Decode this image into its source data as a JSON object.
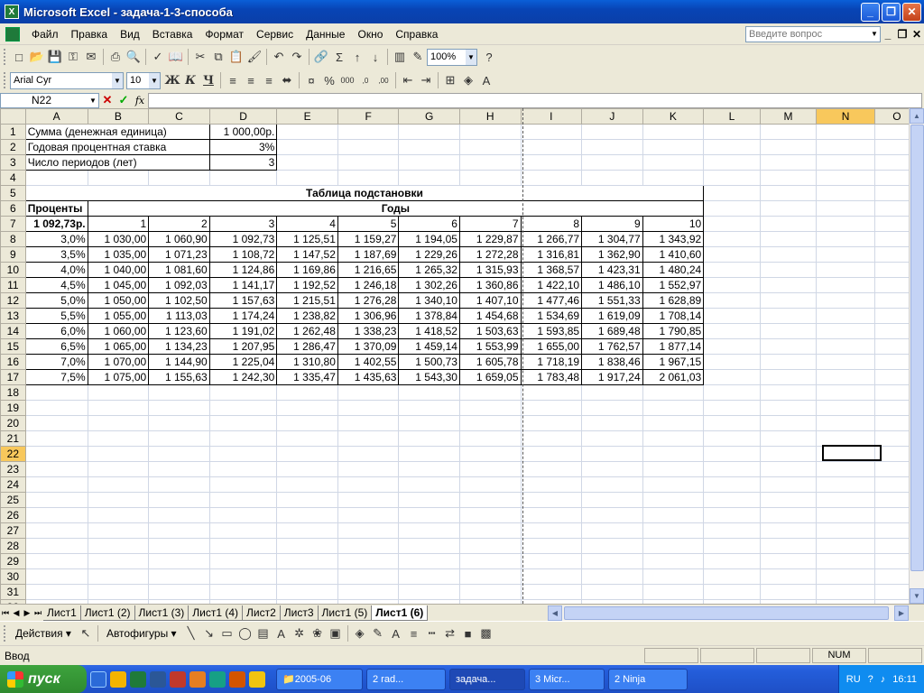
{
  "window": {
    "title": "Microsoft Excel - задача-1-3-способа"
  },
  "menu": {
    "items": [
      "Файл",
      "Правка",
      "Вид",
      "Вставка",
      "Формат",
      "Сервис",
      "Данные",
      "Окно",
      "Справка"
    ],
    "help_placeholder": "Введите вопрос"
  },
  "toolbar": {
    "zoom": "100%",
    "font": "Arial Cyr",
    "size": "10",
    "bold": "Ж",
    "italic": "К",
    "underline": "Ч"
  },
  "formula": {
    "namebox": "N22",
    "fx": "fx",
    "value": ""
  },
  "columns": [
    "A",
    "B",
    "C",
    "D",
    "E",
    "F",
    "G",
    "H",
    "I",
    "J",
    "K",
    "L",
    "M",
    "N",
    "O"
  ],
  "cells": {
    "A1": "Сумма (денежная единица)",
    "D1": "1 000,00р.",
    "A2": "Годовая процентная ставка",
    "D2": "3%",
    "A3": "Число периодов (лет)",
    "D3": "3",
    "E5": "Таблица подстановки",
    "A6": "Проценты",
    "F6": "Годы",
    "A7": "1 092,73р.",
    "years": [
      "1",
      "2",
      "3",
      "4",
      "5",
      "6",
      "7",
      "8",
      "9",
      "10"
    ],
    "rows": [
      {
        "rate": "3,0%",
        "vals": [
          "1 030,00",
          "1 060,90",
          "1 092,73",
          "1 125,51",
          "1 159,27",
          "1 194,05",
          "1 229,87",
          "1 266,77",
          "1 304,77",
          "1 343,92"
        ]
      },
      {
        "rate": "3,5%",
        "vals": [
          "1 035,00",
          "1 071,23",
          "1 108,72",
          "1 147,52",
          "1 187,69",
          "1 229,26",
          "1 272,28",
          "1 316,81",
          "1 362,90",
          "1 410,60"
        ]
      },
      {
        "rate": "4,0%",
        "vals": [
          "1 040,00",
          "1 081,60",
          "1 124,86",
          "1 169,86",
          "1 216,65",
          "1 265,32",
          "1 315,93",
          "1 368,57",
          "1 423,31",
          "1 480,24"
        ]
      },
      {
        "rate": "4,5%",
        "vals": [
          "1 045,00",
          "1 092,03",
          "1 141,17",
          "1 192,52",
          "1 246,18",
          "1 302,26",
          "1 360,86",
          "1 422,10",
          "1 486,10",
          "1 552,97"
        ]
      },
      {
        "rate": "5,0%",
        "vals": [
          "1 050,00",
          "1 102,50",
          "1 157,63",
          "1 215,51",
          "1 276,28",
          "1 340,10",
          "1 407,10",
          "1 477,46",
          "1 551,33",
          "1 628,89"
        ]
      },
      {
        "rate": "5,5%",
        "vals": [
          "1 055,00",
          "1 113,03",
          "1 174,24",
          "1 238,82",
          "1 306,96",
          "1 378,84",
          "1 454,68",
          "1 534,69",
          "1 619,09",
          "1 708,14"
        ]
      },
      {
        "rate": "6,0%",
        "vals": [
          "1 060,00",
          "1 123,60",
          "1 191,02",
          "1 262,48",
          "1 338,23",
          "1 418,52",
          "1 503,63",
          "1 593,85",
          "1 689,48",
          "1 790,85"
        ]
      },
      {
        "rate": "6,5%",
        "vals": [
          "1 065,00",
          "1 134,23",
          "1 207,95",
          "1 286,47",
          "1 370,09",
          "1 459,14",
          "1 553,99",
          "1 655,00",
          "1 762,57",
          "1 877,14"
        ]
      },
      {
        "rate": "7,0%",
        "vals": [
          "1 070,00",
          "1 144,90",
          "1 225,04",
          "1 310,80",
          "1 402,55",
          "1 500,73",
          "1 605,78",
          "1 718,19",
          "1 838,46",
          "1 967,15"
        ]
      },
      {
        "rate": "7,5%",
        "vals": [
          "1 075,00",
          "1 155,63",
          "1 242,30",
          "1 335,47",
          "1 435,63",
          "1 543,30",
          "1 659,05",
          "1 783,48",
          "1 917,24",
          "2 061,03"
        ]
      }
    ]
  },
  "sheets": [
    "Лист1",
    "Лист1 (2)",
    "Лист1 (3)",
    "Лист1 (4)",
    "Лист2",
    "Лист3",
    "Лист1 (5)",
    "Лист1 (6)"
  ],
  "active_sheet": "Лист1 (6)",
  "drawbar": {
    "actions": "Действия ▾",
    "autoshapes": "Автофигуры ▾"
  },
  "status": {
    "mode": "Ввод",
    "num": "NUM"
  },
  "taskbar": {
    "start": "пуск",
    "tasks": [
      "2005-06",
      "2 rad...",
      "задача...",
      "3 Micr...",
      "2 Ninja"
    ],
    "lang": "RU",
    "clock": "16:11"
  }
}
